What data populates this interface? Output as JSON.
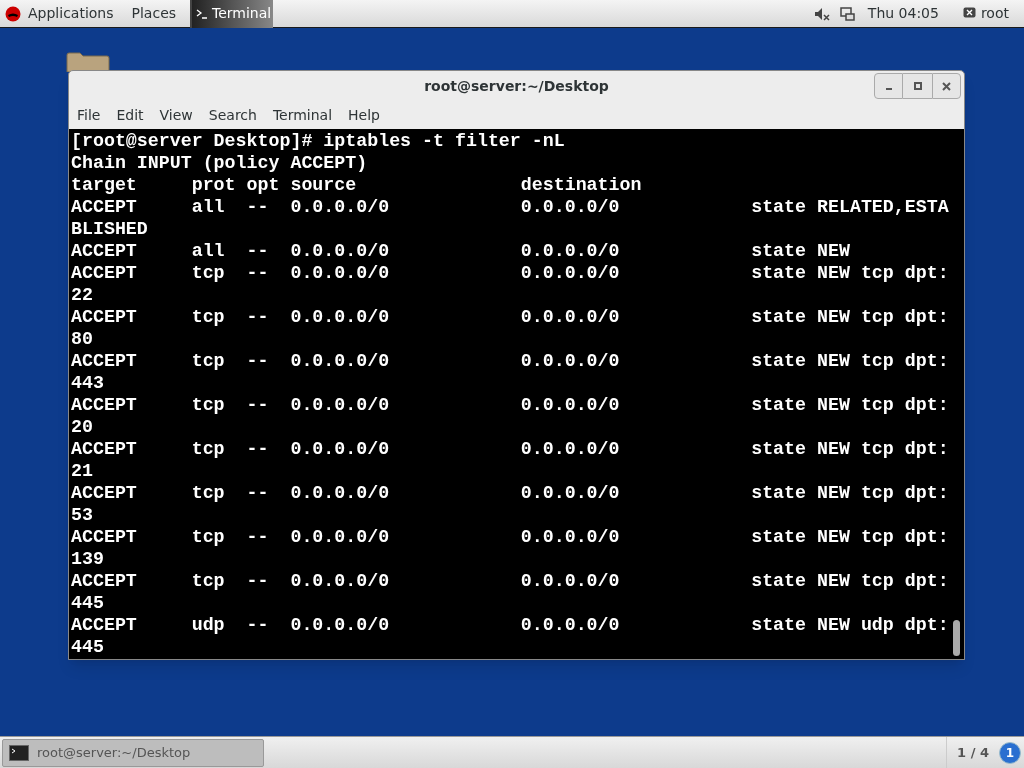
{
  "top_bar": {
    "applications": "Applications",
    "places": "Places",
    "active_app": "Terminal",
    "clock": "Thu 04:05",
    "user": "root"
  },
  "window": {
    "title": "root@server:~/Desktop",
    "menu": [
      "File",
      "Edit",
      "View",
      "Search",
      "Terminal",
      "Help"
    ],
    "terminal_lines": [
      "[root@server Desktop]# iptables -t filter -nL",
      "Chain INPUT (policy ACCEPT)",
      "target     prot opt source               destination",
      "ACCEPT     all  --  0.0.0.0/0            0.0.0.0/0            state RELATED,ESTA",
      "BLISHED",
      "ACCEPT     all  --  0.0.0.0/0            0.0.0.0/0            state NEW",
      "ACCEPT     tcp  --  0.0.0.0/0            0.0.0.0/0            state NEW tcp dpt:",
      "22",
      "ACCEPT     tcp  --  0.0.0.0/0            0.0.0.0/0            state NEW tcp dpt:",
      "80",
      "ACCEPT     tcp  --  0.0.0.0/0            0.0.0.0/0            state NEW tcp dpt:",
      "443",
      "ACCEPT     tcp  --  0.0.0.0/0            0.0.0.0/0            state NEW tcp dpt:",
      "20",
      "ACCEPT     tcp  --  0.0.0.0/0            0.0.0.0/0            state NEW tcp dpt:",
      "21",
      "ACCEPT     tcp  --  0.0.0.0/0            0.0.0.0/0            state NEW tcp dpt:",
      "53",
      "ACCEPT     tcp  --  0.0.0.0/0            0.0.0.0/0            state NEW tcp dpt:",
      "139",
      "ACCEPT     tcp  --  0.0.0.0/0            0.0.0.0/0            state NEW tcp dpt:",
      "445",
      "ACCEPT     udp  --  0.0.0.0/0            0.0.0.0/0            state NEW udp dpt:",
      "445"
    ]
  },
  "taskbar": {
    "task": "root@server:~/Desktop",
    "workspace": "1 / 4",
    "notification_count": "1"
  }
}
